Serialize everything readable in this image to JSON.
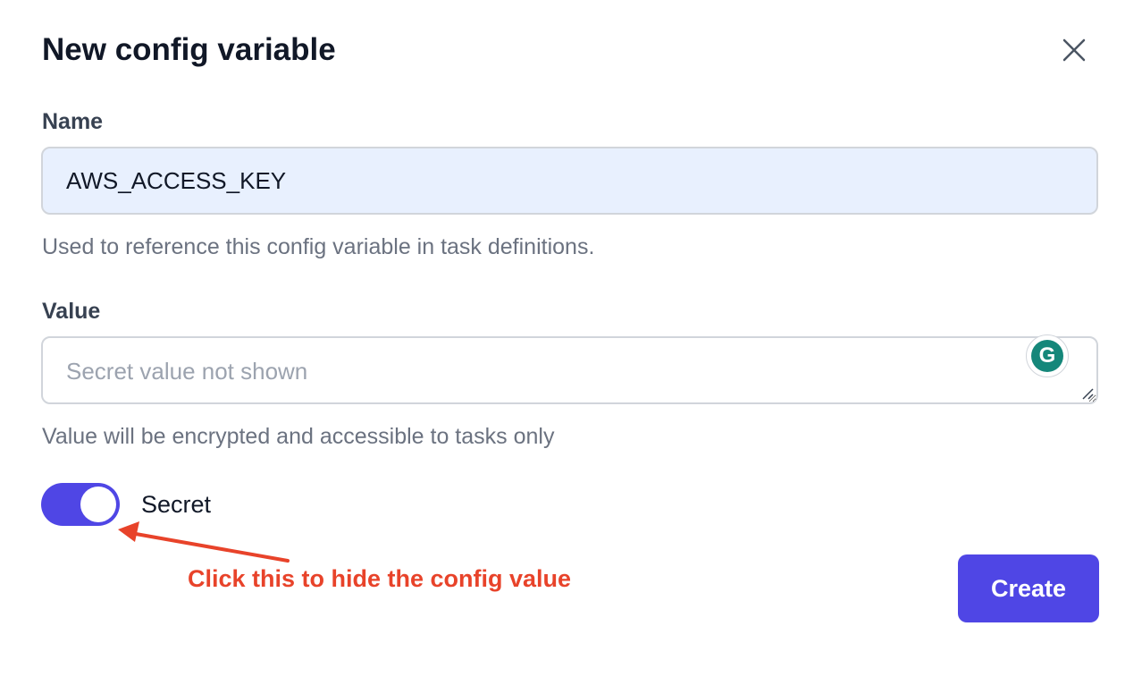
{
  "dialog": {
    "title": "New config variable"
  },
  "name_field": {
    "label": "Name",
    "value": "AWS_ACCESS_KEY",
    "help": "Used to reference this config variable in task definitions."
  },
  "value_field": {
    "label": "Value",
    "placeholder": "Secret value not shown",
    "help": "Value will be encrypted and accessible to tasks only"
  },
  "secret_toggle": {
    "label": "Secret",
    "checked": true
  },
  "annotation": {
    "text": "Click this to hide the config value",
    "color": "#e8432a"
  },
  "actions": {
    "create_label": "Create"
  },
  "grammarly": {
    "letter": "G"
  },
  "colors": {
    "accent": "#4f46e5",
    "name_input_bg": "#e8f0fe",
    "grammarly": "#15877a"
  }
}
